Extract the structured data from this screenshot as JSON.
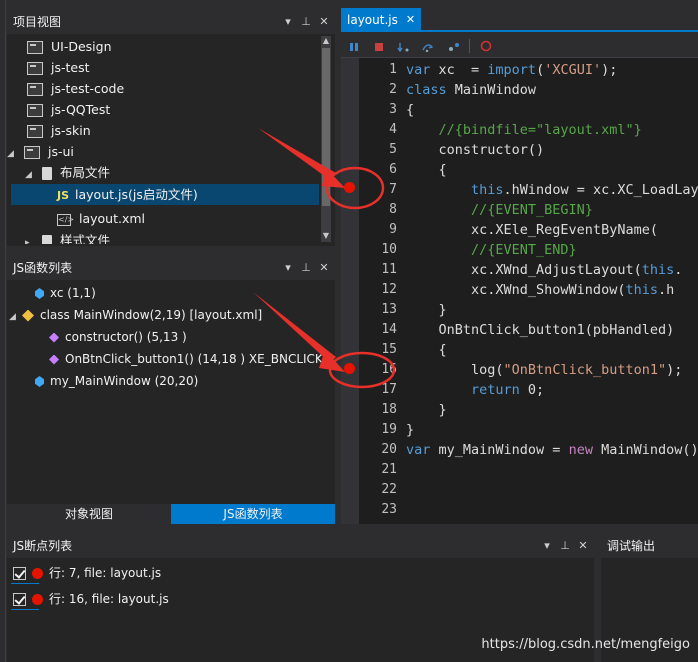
{
  "project_panel": {
    "title": "项目视图",
    "items": [
      {
        "label": "UI-Design",
        "kind": "project"
      },
      {
        "label": "js-test",
        "kind": "project"
      },
      {
        "label": "js-test-code",
        "kind": "project"
      },
      {
        "label": "js-QQTest",
        "kind": "project"
      },
      {
        "label": "js-skin",
        "kind": "project"
      },
      {
        "label": "js-ui",
        "kind": "project-expanded"
      },
      {
        "label": "布局文件",
        "kind": "folder"
      },
      {
        "label": "layout.js(js启动文件)",
        "kind": "js-file",
        "badge": "JS"
      },
      {
        "label": "layout.xml",
        "kind": "xml-file"
      },
      {
        "label": "样式文件",
        "kind": "folder"
      }
    ]
  },
  "function_panel": {
    "title": "JS函数列表",
    "items": [
      {
        "label": "xc (1,1)",
        "kind": "var"
      },
      {
        "label": "class MainWindow(2,19) [layout.xml]",
        "kind": "class"
      },
      {
        "label": "constructor() (5,13 )",
        "kind": "method"
      },
      {
        "label": "OnBtnClick_button1() (14,18 ) XE_BNCLICK",
        "kind": "method"
      },
      {
        "label": "my_MainWindow (20,20)",
        "kind": "var"
      }
    ],
    "tabs": [
      "对象视图",
      "JS函数列表"
    ]
  },
  "editor": {
    "tab_title": "layout.js",
    "tab_close": "✕",
    "line_numbers": [
      "1",
      "2",
      "3",
      "4",
      "5",
      "6",
      "7",
      "8",
      "9",
      "10",
      "11",
      "12",
      "13",
      "14",
      "15",
      "16",
      "17",
      "18",
      "19",
      "20",
      "21",
      "22",
      "23"
    ],
    "breakpoint_lines": [
      7,
      16
    ]
  },
  "breakpoint_panel": {
    "title": "JS断点列表",
    "items": [
      {
        "text": "行: 7,  file: layout.js"
      },
      {
        "text": "行: 16,  file: layout.js"
      }
    ]
  },
  "output_panel": {
    "title": "调试输出"
  },
  "watermark": "https://blog.csdn.net/mengfeigo",
  "colors": {
    "accent": "#007acc",
    "breakpoint": "#e51400",
    "annotation": "#e8302a"
  }
}
